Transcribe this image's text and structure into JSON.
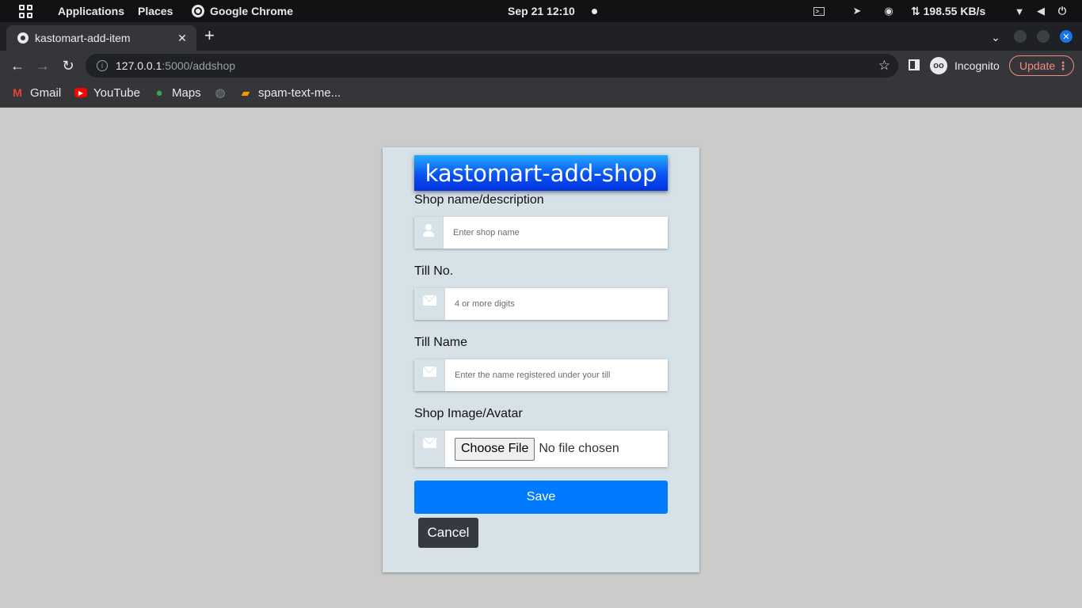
{
  "system_bar": {
    "applications": "Applications",
    "places": "Places",
    "active_app": "Google Chrome",
    "clock": "Sep 21  12:10",
    "net_speed": "⇅ 198.55 KB/s"
  },
  "browser": {
    "tab_title": "kastomart-add-item",
    "url_host": "127.0.0.1",
    "url_path": ":5000/addshop",
    "incognito_label": "Incognito",
    "update_label": "Update",
    "bookmarks": [
      "Gmail",
      "YouTube",
      "Maps",
      "spam-text-me..."
    ]
  },
  "page": {
    "heading": "kastomart-add-shop",
    "fields": [
      {
        "label": "Shop name/description",
        "placeholder": "Enter shop name"
      },
      {
        "label": "Till No.",
        "placeholder": "4 or more digits"
      },
      {
        "label": "Till Name",
        "placeholder": "Enter the name registered under your till"
      },
      {
        "label": "Shop Image/Avatar",
        "button": "Choose File",
        "status": "No file chosen"
      }
    ],
    "save_label": "Save",
    "cancel_label": "Cancel"
  },
  "colors": {
    "page_bg": "#cbcbcb",
    "card_bg": "#d6e1e8",
    "save_button": "#007bff",
    "cancel_button": "#343a40",
    "banner": "#0a52f0"
  }
}
